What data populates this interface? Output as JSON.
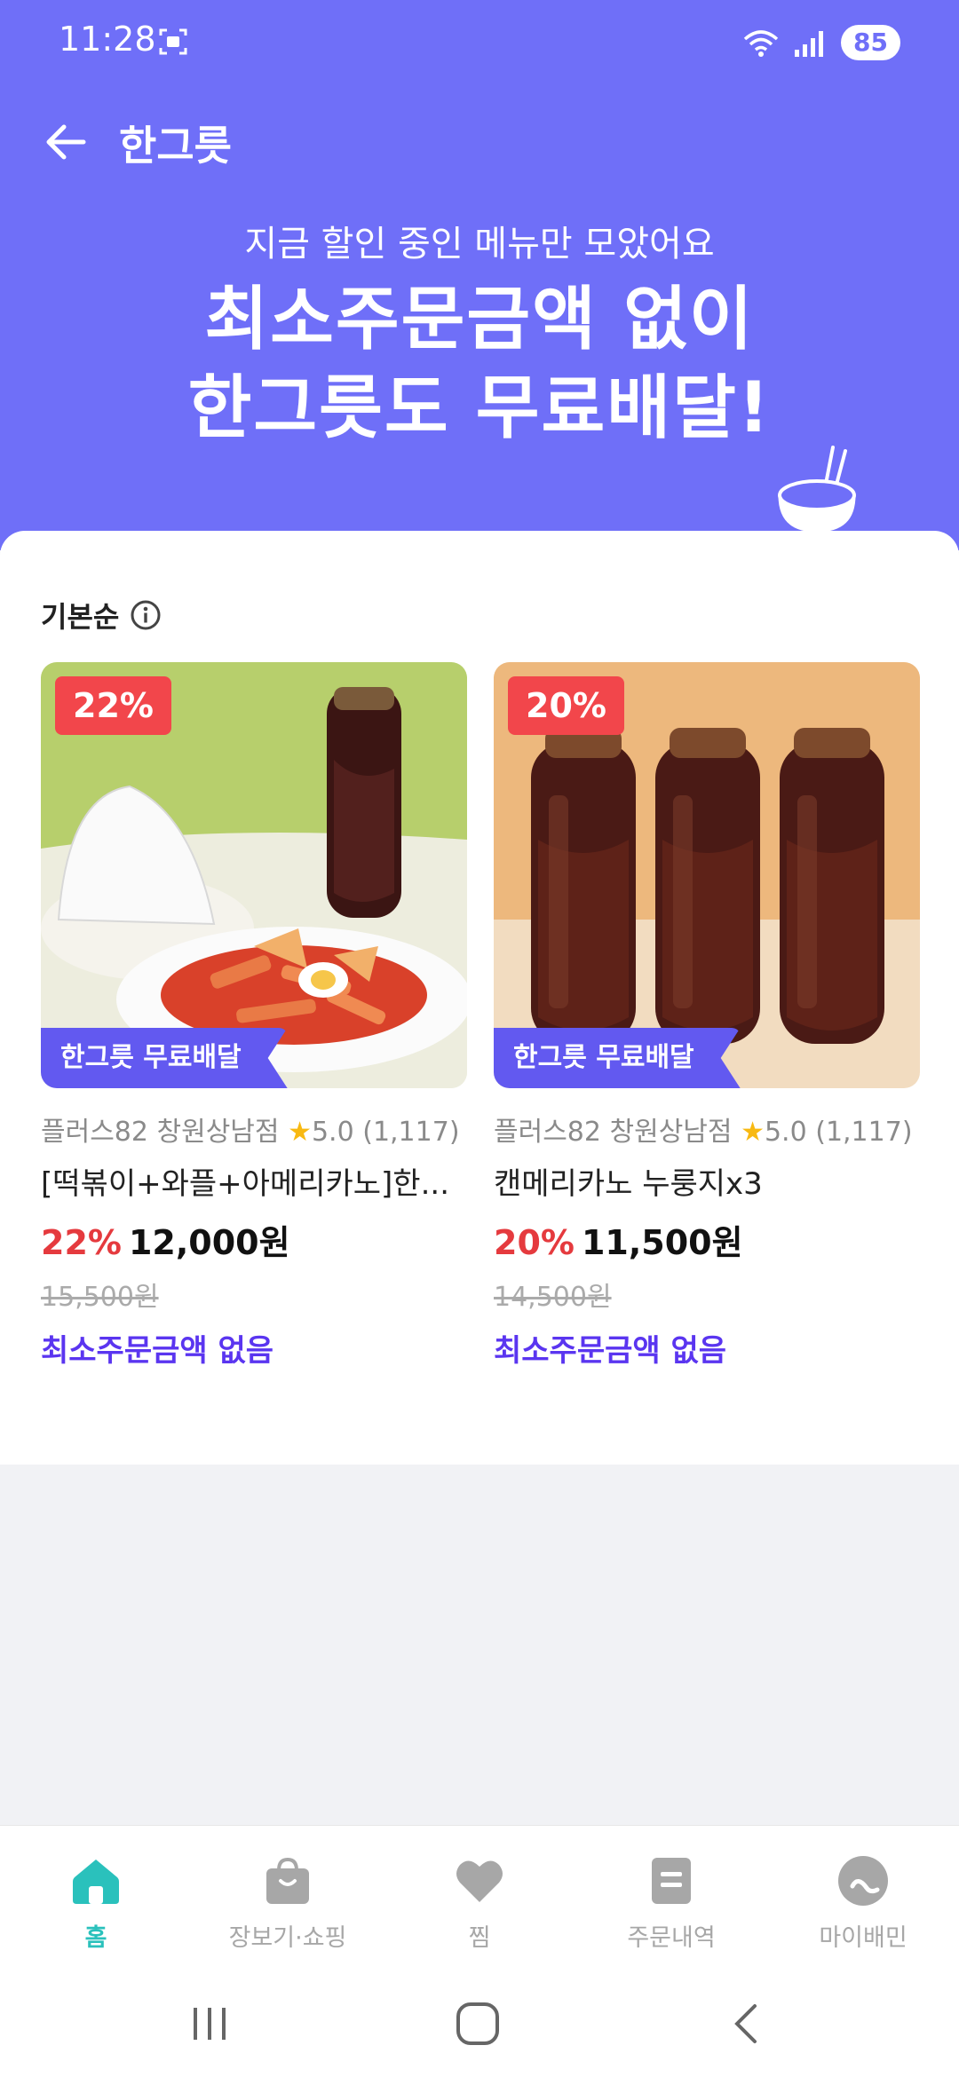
{
  "status": {
    "time": "11:28",
    "battery": "85"
  },
  "header": {
    "title": "한그릇"
  },
  "hero": {
    "subtitle": "지금 할인 중인 메뉴만 모았어요",
    "title_line1": "최소주문금액 없이",
    "title_line2": "한그릇도 무료배달!"
  },
  "sort": {
    "label": "기본순"
  },
  "products": [
    {
      "discount_badge": "22%",
      "free_delivery_tag": "한그릇 무료배달",
      "store": "플러스82 창원상남점",
      "rating": "5.0",
      "reviews": "(1,117)",
      "name": "[떡볶이+와플+아메리카노]한...",
      "discount": "22%",
      "price": "12,000원",
      "original_price": "15,500원",
      "min_order": "최소주문금액 없음"
    },
    {
      "discount_badge": "20%",
      "free_delivery_tag": "한그릇 무료배달",
      "store": "플러스82 창원상남점",
      "rating": "5.0",
      "reviews": "(1,117)",
      "name": "캔메리카노 누룽지x3",
      "discount": "20%",
      "price": "11,500원",
      "original_price": "14,500원",
      "min_order": "최소주문금액 없음"
    }
  ],
  "tabs": [
    {
      "label": "홈",
      "icon": "home-icon",
      "active": true
    },
    {
      "label": "장보기·쇼핑",
      "icon": "shopping-bag-icon"
    },
    {
      "label": "찜",
      "icon": "heart-icon"
    },
    {
      "label": "주문내역",
      "icon": "receipt-icon"
    },
    {
      "label": "마이배민",
      "icon": "profile-icon"
    }
  ],
  "colors": {
    "hero": "#6f6ff8",
    "accent": "#2ac1bc",
    "discount": "#e53a3e",
    "tag": "#6259f0",
    "min_order": "#5a35f0"
  }
}
